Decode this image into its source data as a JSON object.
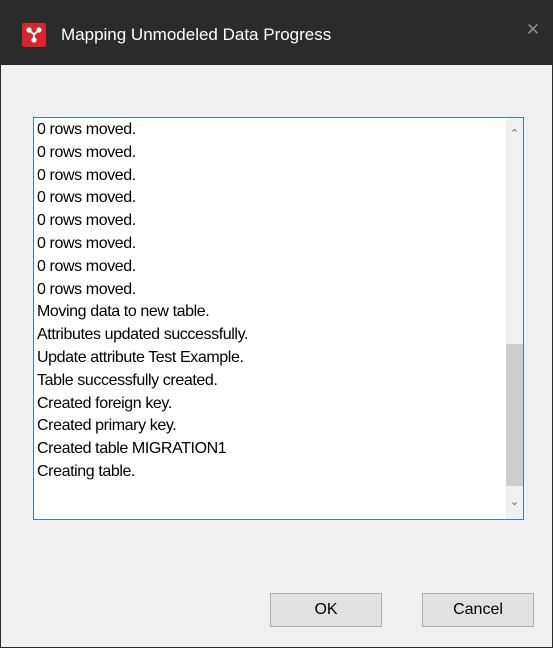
{
  "window": {
    "title": "Mapping Unmodeled Data Progress",
    "close_label": "✕",
    "app_icon": "app-logo-icon",
    "colors": {
      "titlebar": "#2b2b2b",
      "app_icon_bg": "#d8242a",
      "log_border": "#3c7fb1"
    }
  },
  "log": {
    "lines": [
      "0 rows moved.",
      "0 rows moved.",
      "0 rows moved.",
      "0 rows moved.",
      "0 rows moved.",
      "0 rows moved.",
      "0 rows moved.",
      "0 rows moved.",
      "Moving data to new table.",
      "Attributes updated successfully.",
      "Update attribute Test Example.",
      "Table successfully created.",
      "Created foreign key.",
      "Created primary key.",
      "Created table MIGRATION1",
      "Creating table."
    ],
    "scroll_up_icon": "⌃",
    "scroll_down_icon": "⌄"
  },
  "buttons": {
    "ok_label": "OK",
    "cancel_label": "Cancel"
  }
}
